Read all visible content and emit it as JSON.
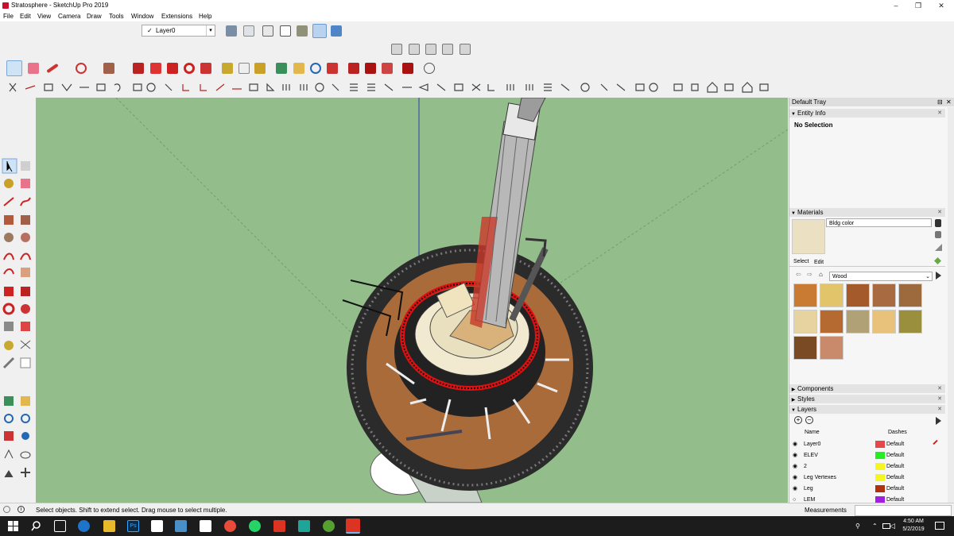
{
  "window": {
    "title": "Stratosphere - SketchUp Pro 2019",
    "controls": {
      "minimize": "–",
      "maximize": "❐",
      "close": "✕"
    }
  },
  "menu": [
    "File",
    "Edit",
    "View",
    "Camera",
    "Draw",
    "Tools",
    "Window",
    "Extensions",
    "Help"
  ],
  "toolbar": {
    "layer_check": "✓",
    "current_layer": "Layer0",
    "dropdown_arrow": "▾"
  },
  "tray": {
    "title": "Default Tray",
    "pin": "⊟",
    "close": "✕",
    "entity_info": {
      "header": "Entity Info",
      "value": "No Selection"
    },
    "materials": {
      "header": "Materials",
      "material_name": "Bldg color",
      "tab_select": "Select",
      "tab_edit": "Edit",
      "collection": "Wood",
      "swatch_colors": [
        "#c97a33",
        "#e2c46a",
        "#a55a2c",
        "#a86a40",
        "#9c6a3c",
        "#e6d3a0",
        "#b46a30",
        "#b0a276",
        "#e8c27a",
        "#9a8f3c",
        "#7a4a24",
        "#c98a6c"
      ],
      "preview_color": "#ece0c2"
    },
    "components": {
      "header": "Components"
    },
    "styles": {
      "header": "Styles"
    },
    "layers": {
      "header": "Layers",
      "col_name": "Name",
      "col_dashes": "Dashes",
      "rows": [
        {
          "name": "Layer0",
          "color": "#e8474a",
          "dashes": "Default",
          "visible": true,
          "current": true
        },
        {
          "name": "ELEV",
          "color": "#22ee22",
          "dashes": "Default",
          "visible": true
        },
        {
          "name": "2",
          "color": "#f5f522",
          "dashes": "Default",
          "visible": true
        },
        {
          "name": "Leg Vertexes",
          "color": "#f5f522",
          "dashes": "Default",
          "visible": true
        },
        {
          "name": "Leg",
          "color": "#b03010",
          "dashes": "Default",
          "visible": true
        },
        {
          "name": "LEM",
          "color": "#a020e0",
          "dashes": "Default",
          "visible": false
        }
      ]
    }
  },
  "status": {
    "message": "Select objects. Shift to extend select. Drag mouse to select multiple.",
    "measurements_label": "Measurements"
  },
  "taskbar": {
    "time": "4:50 AM",
    "date": "5/2/2019"
  }
}
